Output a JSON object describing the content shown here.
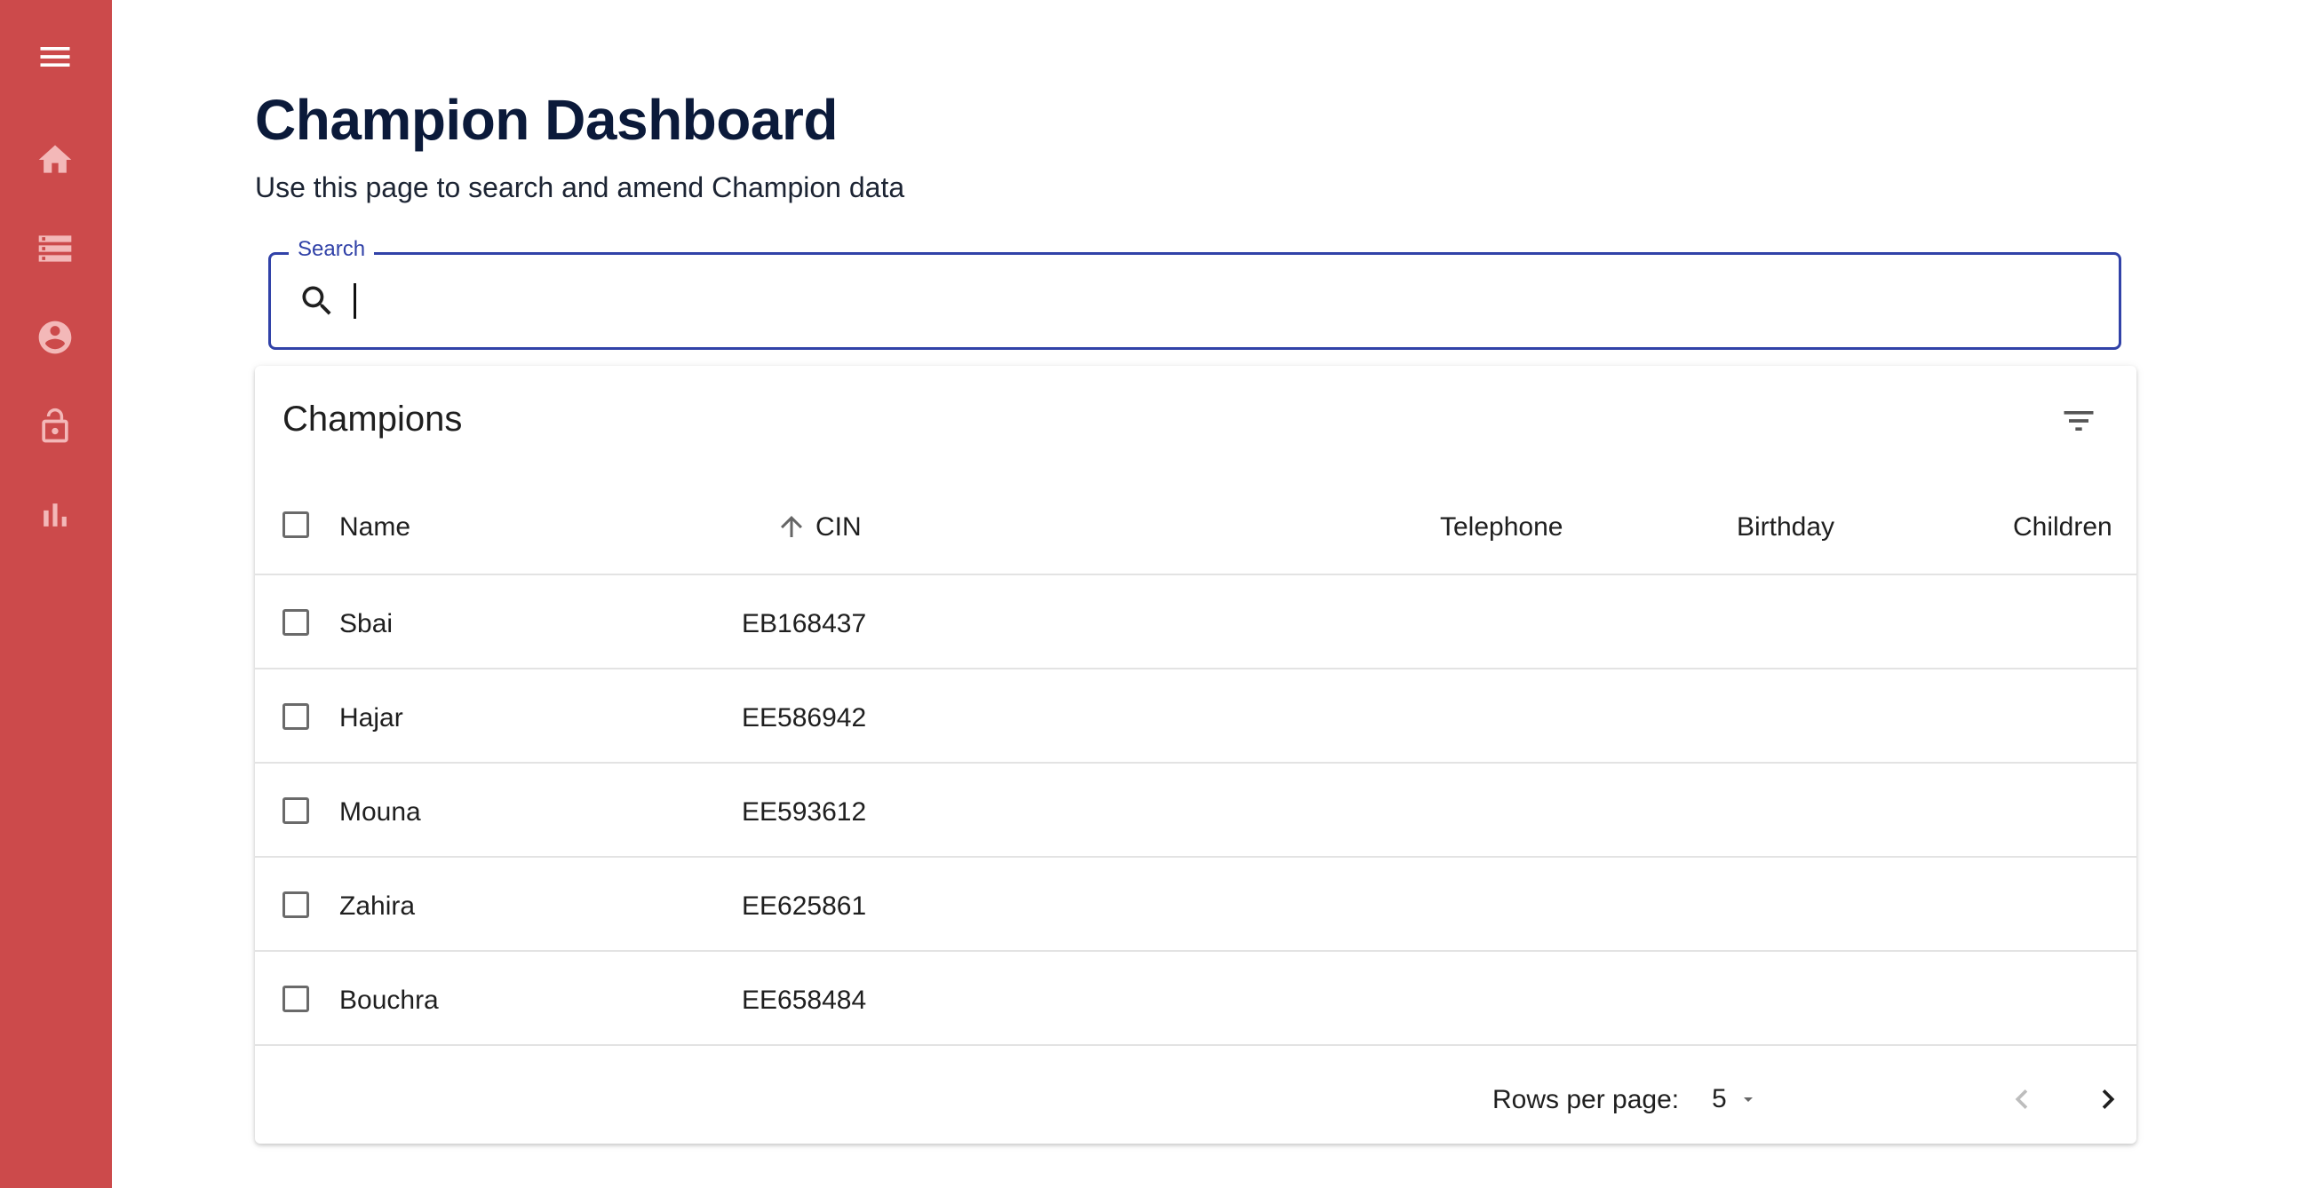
{
  "sidebar": {
    "items": [
      {
        "icon": "menu-icon"
      },
      {
        "icon": "home-icon"
      },
      {
        "icon": "storage-icon"
      },
      {
        "icon": "account-circle-icon"
      },
      {
        "icon": "lock-open-icon"
      },
      {
        "icon": "bar-chart-icon"
      }
    ],
    "background_color": "#cc4a4b"
  },
  "header": {
    "title": "Champion Dashboard",
    "subtitle": "Use this page to search and amend Champion data"
  },
  "search": {
    "label": "Search",
    "value": "",
    "accent_color": "#3142a8"
  },
  "table": {
    "title": "Champions",
    "columns": [
      "Name",
      "CIN",
      "Telephone",
      "Birthday",
      "Children"
    ],
    "sort_column": "CIN",
    "sort_direction": "ascending",
    "rows": [
      {
        "name": "Sbai",
        "cin": "EB168437",
        "telephone": "",
        "birthday": "",
        "children": ""
      },
      {
        "name": "Hajar",
        "cin": "EE586942",
        "telephone": "",
        "birthday": "",
        "children": ""
      },
      {
        "name": "Mouna",
        "cin": "EE593612",
        "telephone": "",
        "birthday": "",
        "children": ""
      },
      {
        "name": "Zahira",
        "cin": "EE625861",
        "telephone": "",
        "birthday": "",
        "children": ""
      },
      {
        "name": "Bouchra",
        "cin": "EE658484",
        "telephone": "",
        "birthday": "",
        "children": ""
      }
    ]
  },
  "pagination": {
    "rows_per_page_label": "Rows per page:",
    "rows_per_page_value": "5"
  }
}
